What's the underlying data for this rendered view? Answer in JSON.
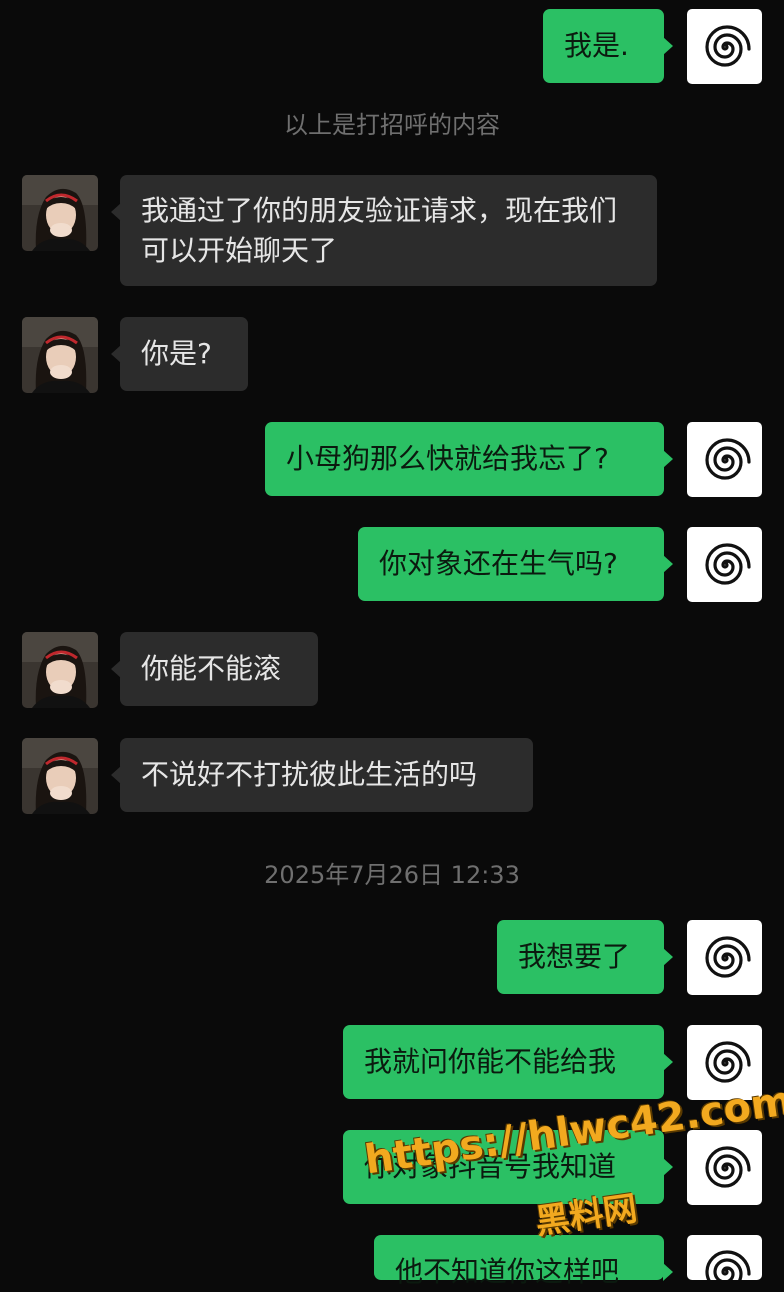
{
  "messages": {
    "m1": "我是.",
    "sys1": "以上是打招呼的内容",
    "m2": "我通过了你的朋友验证请求，现在我们可以开始聊天了",
    "m3": "你是?",
    "m4": "小母狗那么快就给我忘了?",
    "m5": "你对象还在生气吗?",
    "m6": "你能不能滚",
    "m7": "不说好不打扰彼此生活的吗",
    "timestamp": "2025年7月26日 12:33",
    "m8": "我想要了",
    "m9": "我就问你能不能给我",
    "m10": "你对象抖音号我知道",
    "m11": "他不知道你这样吧"
  },
  "watermark": {
    "url": "https://hlwc42.com",
    "name": "黑料网"
  },
  "colors": {
    "background": "#0a0a0a",
    "my_bubble": "#2bc064",
    "their_bubble": "#2c2c2c",
    "system_text": "#6f6f6f",
    "watermark": "#f2a91f"
  },
  "icons": {
    "my_avatar": "spiral-icon",
    "their_avatar": "person-photo"
  }
}
